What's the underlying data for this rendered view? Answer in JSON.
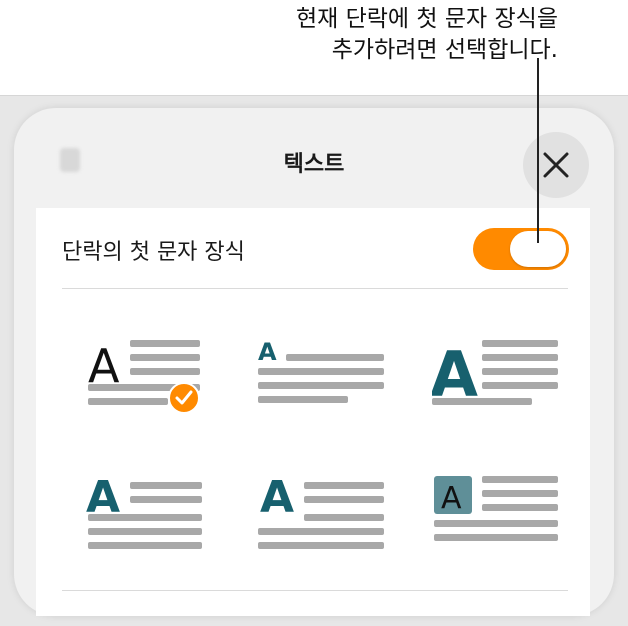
{
  "callout": {
    "line1": "현재 단락에 첫 문자 장식을",
    "line2": "추가하려면 선택합니다."
  },
  "header": {
    "title": "텍스트",
    "ghost_icon": "blurred-tab-icon",
    "close_icon": "close-x"
  },
  "drop_cap": {
    "label": "단락의 첫 문자 장식",
    "enabled": true
  },
  "styles": {
    "items": [
      {
        "id": "style-1",
        "letter": "A",
        "selected": true
      },
      {
        "id": "style-2",
        "letter": "A",
        "selected": false
      },
      {
        "id": "style-3",
        "letter": "A",
        "selected": false
      },
      {
        "id": "style-4",
        "letter": "A",
        "selected": false
      },
      {
        "id": "style-5",
        "letter": "A",
        "selected": false
      },
      {
        "id": "style-6",
        "letter": "A",
        "selected": false
      }
    ]
  },
  "colors": {
    "accent": "#ff8a00",
    "teal": "#17606e",
    "line_gray": "#a8a8a8",
    "tile_teal": "#5f8f98"
  }
}
